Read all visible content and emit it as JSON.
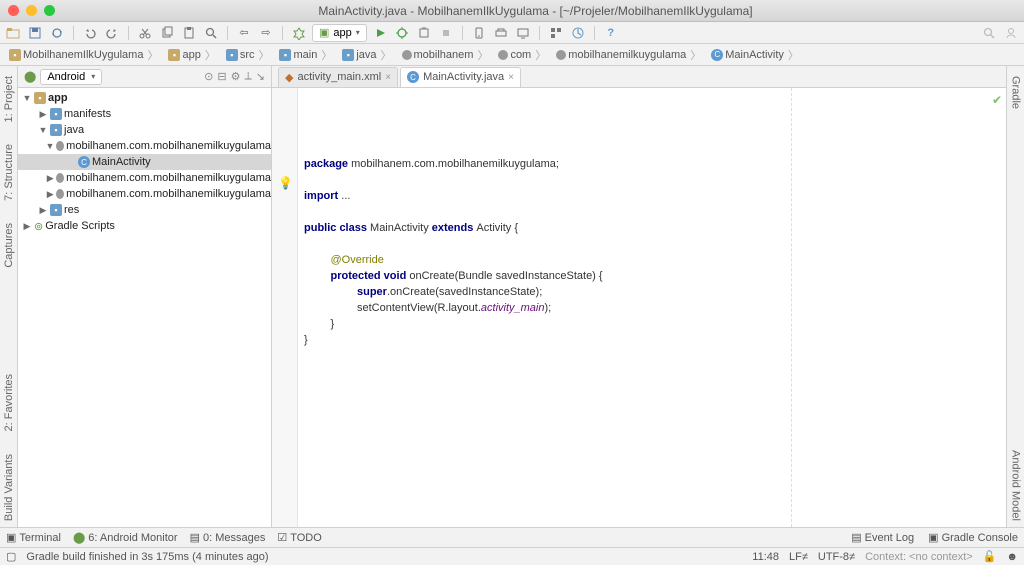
{
  "title": "MainActivity.java - MobilhanemIlkUygulama - [~/Projeler/MobilhanemIlkUygulama]",
  "run_config": "app",
  "breadcrumbs": [
    {
      "icon": "folder",
      "label": "MobilhanemIlkUygulama"
    },
    {
      "icon": "folder",
      "label": "app"
    },
    {
      "icon": "folder-blue",
      "label": "src"
    },
    {
      "icon": "folder-blue",
      "label": "main"
    },
    {
      "icon": "folder-blue",
      "label": "java"
    },
    {
      "icon": "pkg",
      "label": "mobilhanem"
    },
    {
      "icon": "pkg",
      "label": "com"
    },
    {
      "icon": "pkg",
      "label": "mobilhanemilkuygulama"
    },
    {
      "icon": "class",
      "label": "MainActivity"
    }
  ],
  "left_strip": [
    {
      "label": "1: Project"
    },
    {
      "label": "7: Structure"
    },
    {
      "label": "Captures"
    },
    {
      "label": "2: Favorites"
    },
    {
      "label": "Build Variants"
    }
  ],
  "right_strip": [
    {
      "label": "Gradle"
    },
    {
      "label": "Android Model"
    }
  ],
  "project_panel": {
    "view": "Android",
    "tree": {
      "app": "app",
      "manifests": "manifests",
      "java": "java",
      "pkg1": "mobilhanem.com.mobilhanemilkuygulama",
      "class1": "MainActivity",
      "pkg2": "mobilhanem.com.mobilhanemilkuygulama",
      "pkg3": "mobilhanem.com.mobilhanemilkuygulama",
      "res": "res",
      "gradle": "Gradle Scripts"
    }
  },
  "editor_tabs": [
    {
      "label": "activity_main.xml",
      "active": false
    },
    {
      "label": "MainActivity.java",
      "active": true
    }
  ],
  "code": {
    "l1a": "package",
    "l1b": " mobilhanem.com.mobilhanemilkuygulama;",
    "l2a": "import",
    "l2b": " ...",
    "l3a": "public class ",
    "l3b": "MainActivity ",
    "l3c": "extends ",
    "l3d": "Activity {",
    "l4": "@Override",
    "l5a": "protected void ",
    "l5b": "onCreate(Bundle savedInstanceState) {",
    "l6a": "super",
    "l6b": ".onCreate(savedInstanceState);",
    "l7a": "setContentView(R.layout.",
    "l7b": "activity_main",
    "l7c": ");",
    "l8": "}",
    "l9": "}"
  },
  "bottom_tools": {
    "terminal": "Terminal",
    "android_monitor": "6: Android Monitor",
    "messages": "0: Messages",
    "todo": "TODO",
    "event_log": "Event Log",
    "gradle_console": "Gradle Console"
  },
  "status": {
    "msg": "Gradle build finished in 3s 175ms (4 minutes ago)",
    "pos": "11:48",
    "sep": "LF≠",
    "enc": "UTF-8≠",
    "ctx": "Context: <no context>"
  }
}
